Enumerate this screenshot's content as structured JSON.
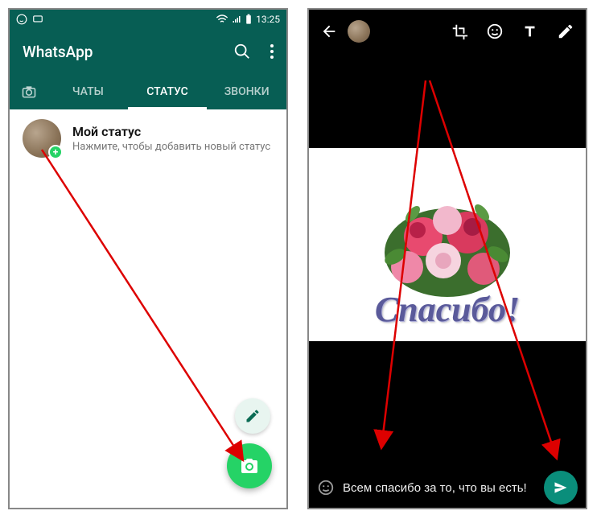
{
  "status_bar": {
    "time": "13:25"
  },
  "app_title": "WhatsApp",
  "tabs": {
    "chats": "ЧАТЫ",
    "status": "СТАТУС",
    "calls": "ЗВОНКИ"
  },
  "my_status": {
    "title": "Мой статус",
    "subtitle": "Нажмите, чтобы добавить новый статус"
  },
  "editor": {
    "image_text": "Спасибо!",
    "caption": "Всем спасибо за то, что вы есть!"
  },
  "colors": {
    "primary": "#075E54",
    "accent": "#25D366",
    "send": "#0a8e7b"
  }
}
